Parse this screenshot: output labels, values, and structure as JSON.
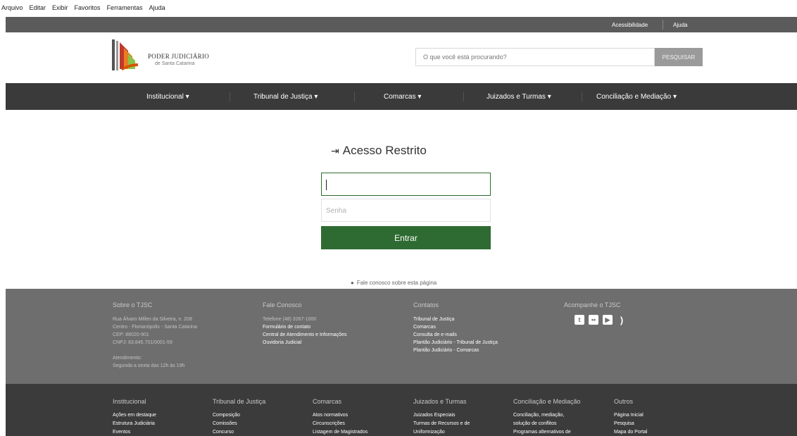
{
  "menubar": {
    "items": [
      "Arquivo",
      "Editar",
      "Exibir",
      "Favoritos",
      "Ferramentas",
      "Ajuda"
    ]
  },
  "utilbar": {
    "accessibility": "Acessibilidade",
    "help": "Ajuda"
  },
  "header": {
    "logo_line1": "PODER JUDICIÁRIO",
    "logo_line2": "de Santa Catarina",
    "search_placeholder": "O que você está procurando?",
    "search_button": "PESQUISAR"
  },
  "nav": {
    "items": [
      "Institucional ▾",
      "Tribunal de Justiça ▾",
      "Comarcas ▾",
      "Juizados e Turmas ▾",
      "Conciliação e Mediação ▾"
    ]
  },
  "login": {
    "icon": "sign-in-icon",
    "title": "Acesso Restrito",
    "username_value": "",
    "password_placeholder": "Senha",
    "submit": "Entrar"
  },
  "feedback": {
    "icon": "comment-icon",
    "text": "Fale conosco sobre esta página"
  },
  "footer_top": {
    "col1": {
      "title": "Sobre o TJSC",
      "lines": [
        "Rua Álvaro Millen da Silveira, n. 208",
        "Centro - Florianópolis - Santa Catarina",
        "CEP: 88020-901",
        "CNPJ: 83.845.701/0001-59",
        "Atendimento:",
        "Segunda a sexta das 12h às 19h"
      ]
    },
    "col2": {
      "title": "Fale Conosco",
      "phone": "Telefone (48) 3287-1000",
      "links": [
        "Formulário de contato",
        "Central de Atendimento e Informações",
        "Ouvidoria Judicial"
      ]
    },
    "col3": {
      "title": "Contatos",
      "links": [
        "Tribunal de Justiça",
        "Comarcas",
        "Consulta de e-mails",
        "Plantão Judiciário - Tribunal de Justiça",
        "Plantão Judiciário - Comarcas"
      ]
    },
    "col4": {
      "title": "Acompanhe o TJSC",
      "icons": [
        "twitter-icon",
        "flickr-icon",
        "youtube-icon",
        "rss-icon"
      ]
    }
  },
  "footer_bottom": {
    "columns": [
      {
        "title": "Institucional",
        "links": [
          "Ações em destaque",
          "Estrutura Judiciária",
          "Eventos"
        ]
      },
      {
        "title": "Tribunal de Justiça",
        "links": [
          "Composição",
          "Comissões",
          "Concurso"
        ]
      },
      {
        "title": "Comarcas",
        "links": [
          "Atos normativos",
          "Circunscrições",
          "Listagem de Magistrados"
        ]
      },
      {
        "title": "Juizados e Turmas",
        "links": [
          "Juizados Especiais",
          "Turmas de Recursos e de",
          "Uniformização"
        ]
      },
      {
        "title": "Conciliação e Mediação",
        "links": [
          "Conciliação, mediação,",
          "solução de conflitos",
          "Programas alternativos de"
        ]
      },
      {
        "title": "Outros",
        "links": [
          "Página Inicial",
          "Pesquisa",
          "Mapa do Portal"
        ]
      }
    ]
  },
  "colors": {
    "nav_bg": "#3a3a3a",
    "util_bg": "#5b5b5b",
    "button_green": "#2e6b32",
    "footer_top": "#6e6e6e",
    "footer_bottom": "#3b3b3b"
  }
}
